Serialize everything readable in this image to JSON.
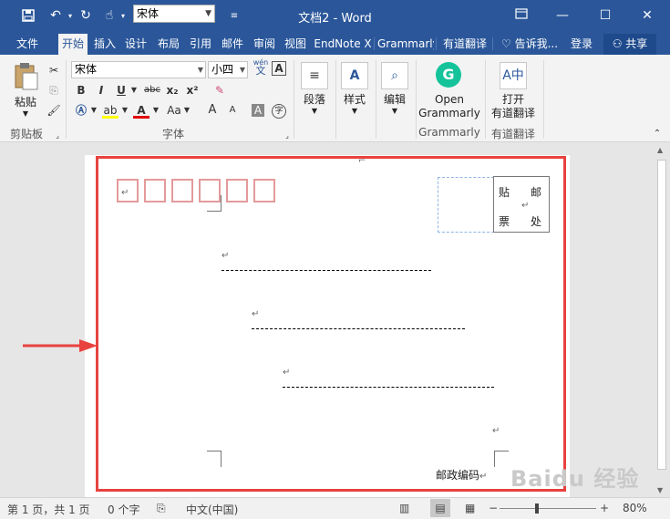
{
  "titlebar": {
    "save_icon": "save-icon",
    "undo_icon": "undo-icon",
    "redo_icon": "redo-icon",
    "touch_icon": "touch-mode-icon",
    "font_name": "宋体",
    "customize_icon": "customize-qat-icon",
    "title": "文档2 - Word",
    "ribbon_display_icon": "ribbon-display-icon"
  },
  "tabs": [
    "文件",
    "开始",
    "插入",
    "设计",
    "布局",
    "引用",
    "邮件",
    "审阅",
    "视图",
    "EndNote X",
    "Grammarly",
    "有道翻译"
  ],
  "tell_me": "告诉我...",
  "login": "登录",
  "share": "共享",
  "ribbon": {
    "paste": "粘贴",
    "clipboard": "剪贴板",
    "font_family": "宋体",
    "font_size": "小四",
    "phonetic": "wén",
    "phonetic_char": "文",
    "font_group": "字体",
    "bold": "B",
    "italic": "I",
    "underline": "U",
    "strike": "abc",
    "subscript": "x₂",
    "superscript": "x²",
    "grow": "A",
    "shrink": "A",
    "shade_char": "A",
    "encircle": "字",
    "paragraph": "段落",
    "styles": "样式",
    "editing": "编辑",
    "open": "Open",
    "grammarly": "Grammarly",
    "grammarly_group": "Grammarly",
    "open2": "打开",
    "youdao": "有道翻译",
    "youdao_group": "有道翻译"
  },
  "document": {
    "stamp_left_top": "贴",
    "stamp_right_top": "邮",
    "stamp_left_bottom": "票",
    "stamp_right_bottom": "处",
    "postcode_label": "邮政编码",
    "para_mark": "↵"
  },
  "status": {
    "page": "第 1 页，共 1 页",
    "words": "0 个字",
    "language": "中文(中国)",
    "zoom": "80%",
    "zoom_level": 0.8
  },
  "watermark": "Baidu 经验",
  "colors": {
    "accent": "#2b579a",
    "highlight_frame": "#e8423f",
    "postcode_box": "#e39a9b"
  }
}
